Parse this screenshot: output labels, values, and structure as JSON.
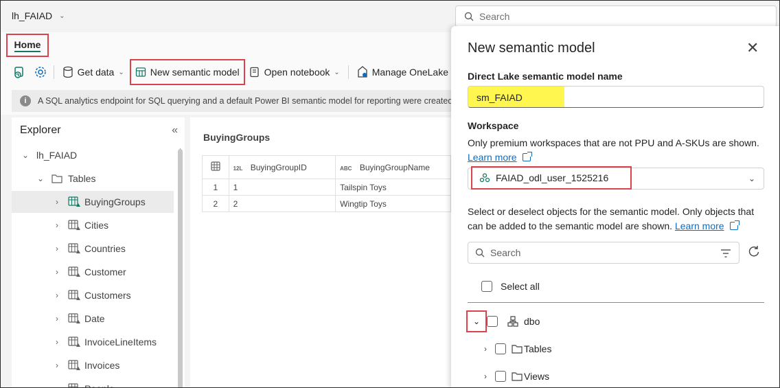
{
  "topbar": {
    "workspace_item": "lh_FAIAD",
    "search_placeholder": "Search"
  },
  "ribbon": {
    "home_tab": "Home",
    "get_data": "Get data",
    "new_semantic_model": "New semantic model",
    "open_notebook": "Open notebook",
    "manage_onelake": "Manage OneLake"
  },
  "info_message": "A SQL analytics endpoint for SQL querying and a default Power BI semantic model for reporting were created with",
  "explorer": {
    "title": "Explorer",
    "root": "lh_FAIAD",
    "tables_folder": "Tables",
    "tables": [
      "BuyingGroups",
      "Cities",
      "Countries",
      "Customer",
      "Customers",
      "Date",
      "InvoiceLineItems",
      "Invoices",
      "People"
    ]
  },
  "table_preview": {
    "title": "BuyingGroups",
    "columns": [
      {
        "type": "12L",
        "name": "BuyingGroupID"
      },
      {
        "type": "ABC",
        "name": "BuyingGroupName"
      }
    ],
    "rows": [
      {
        "row": "1",
        "id": "1",
        "name": "Tailspin Toys"
      },
      {
        "row": "2",
        "id": "2",
        "name": "Wingtip Toys"
      }
    ]
  },
  "panel": {
    "title": "New semantic model",
    "name_label": "Direct Lake semantic model name",
    "name_value": "sm_FAIAD",
    "workspace_label": "Workspace",
    "workspace_note": "Only premium workspaces that are not PPU and A-SKUs are shown.",
    "learn_more": "Learn more",
    "workspace_value": "FAIAD_odl_user_1525216",
    "select_note_1": "Select or deselect objects for the semantic model. Only objects that",
    "select_note_2": "can be added to the semantic model are shown.",
    "search_placeholder": "Search",
    "select_all": "Select all",
    "schema": "dbo",
    "children": [
      "Tables",
      "Views"
    ]
  },
  "colors": {
    "highlight_border": "#d9434b",
    "name_highlight": "#fff64f",
    "link": "#0f6cbd",
    "brand_teal": "#117865"
  }
}
